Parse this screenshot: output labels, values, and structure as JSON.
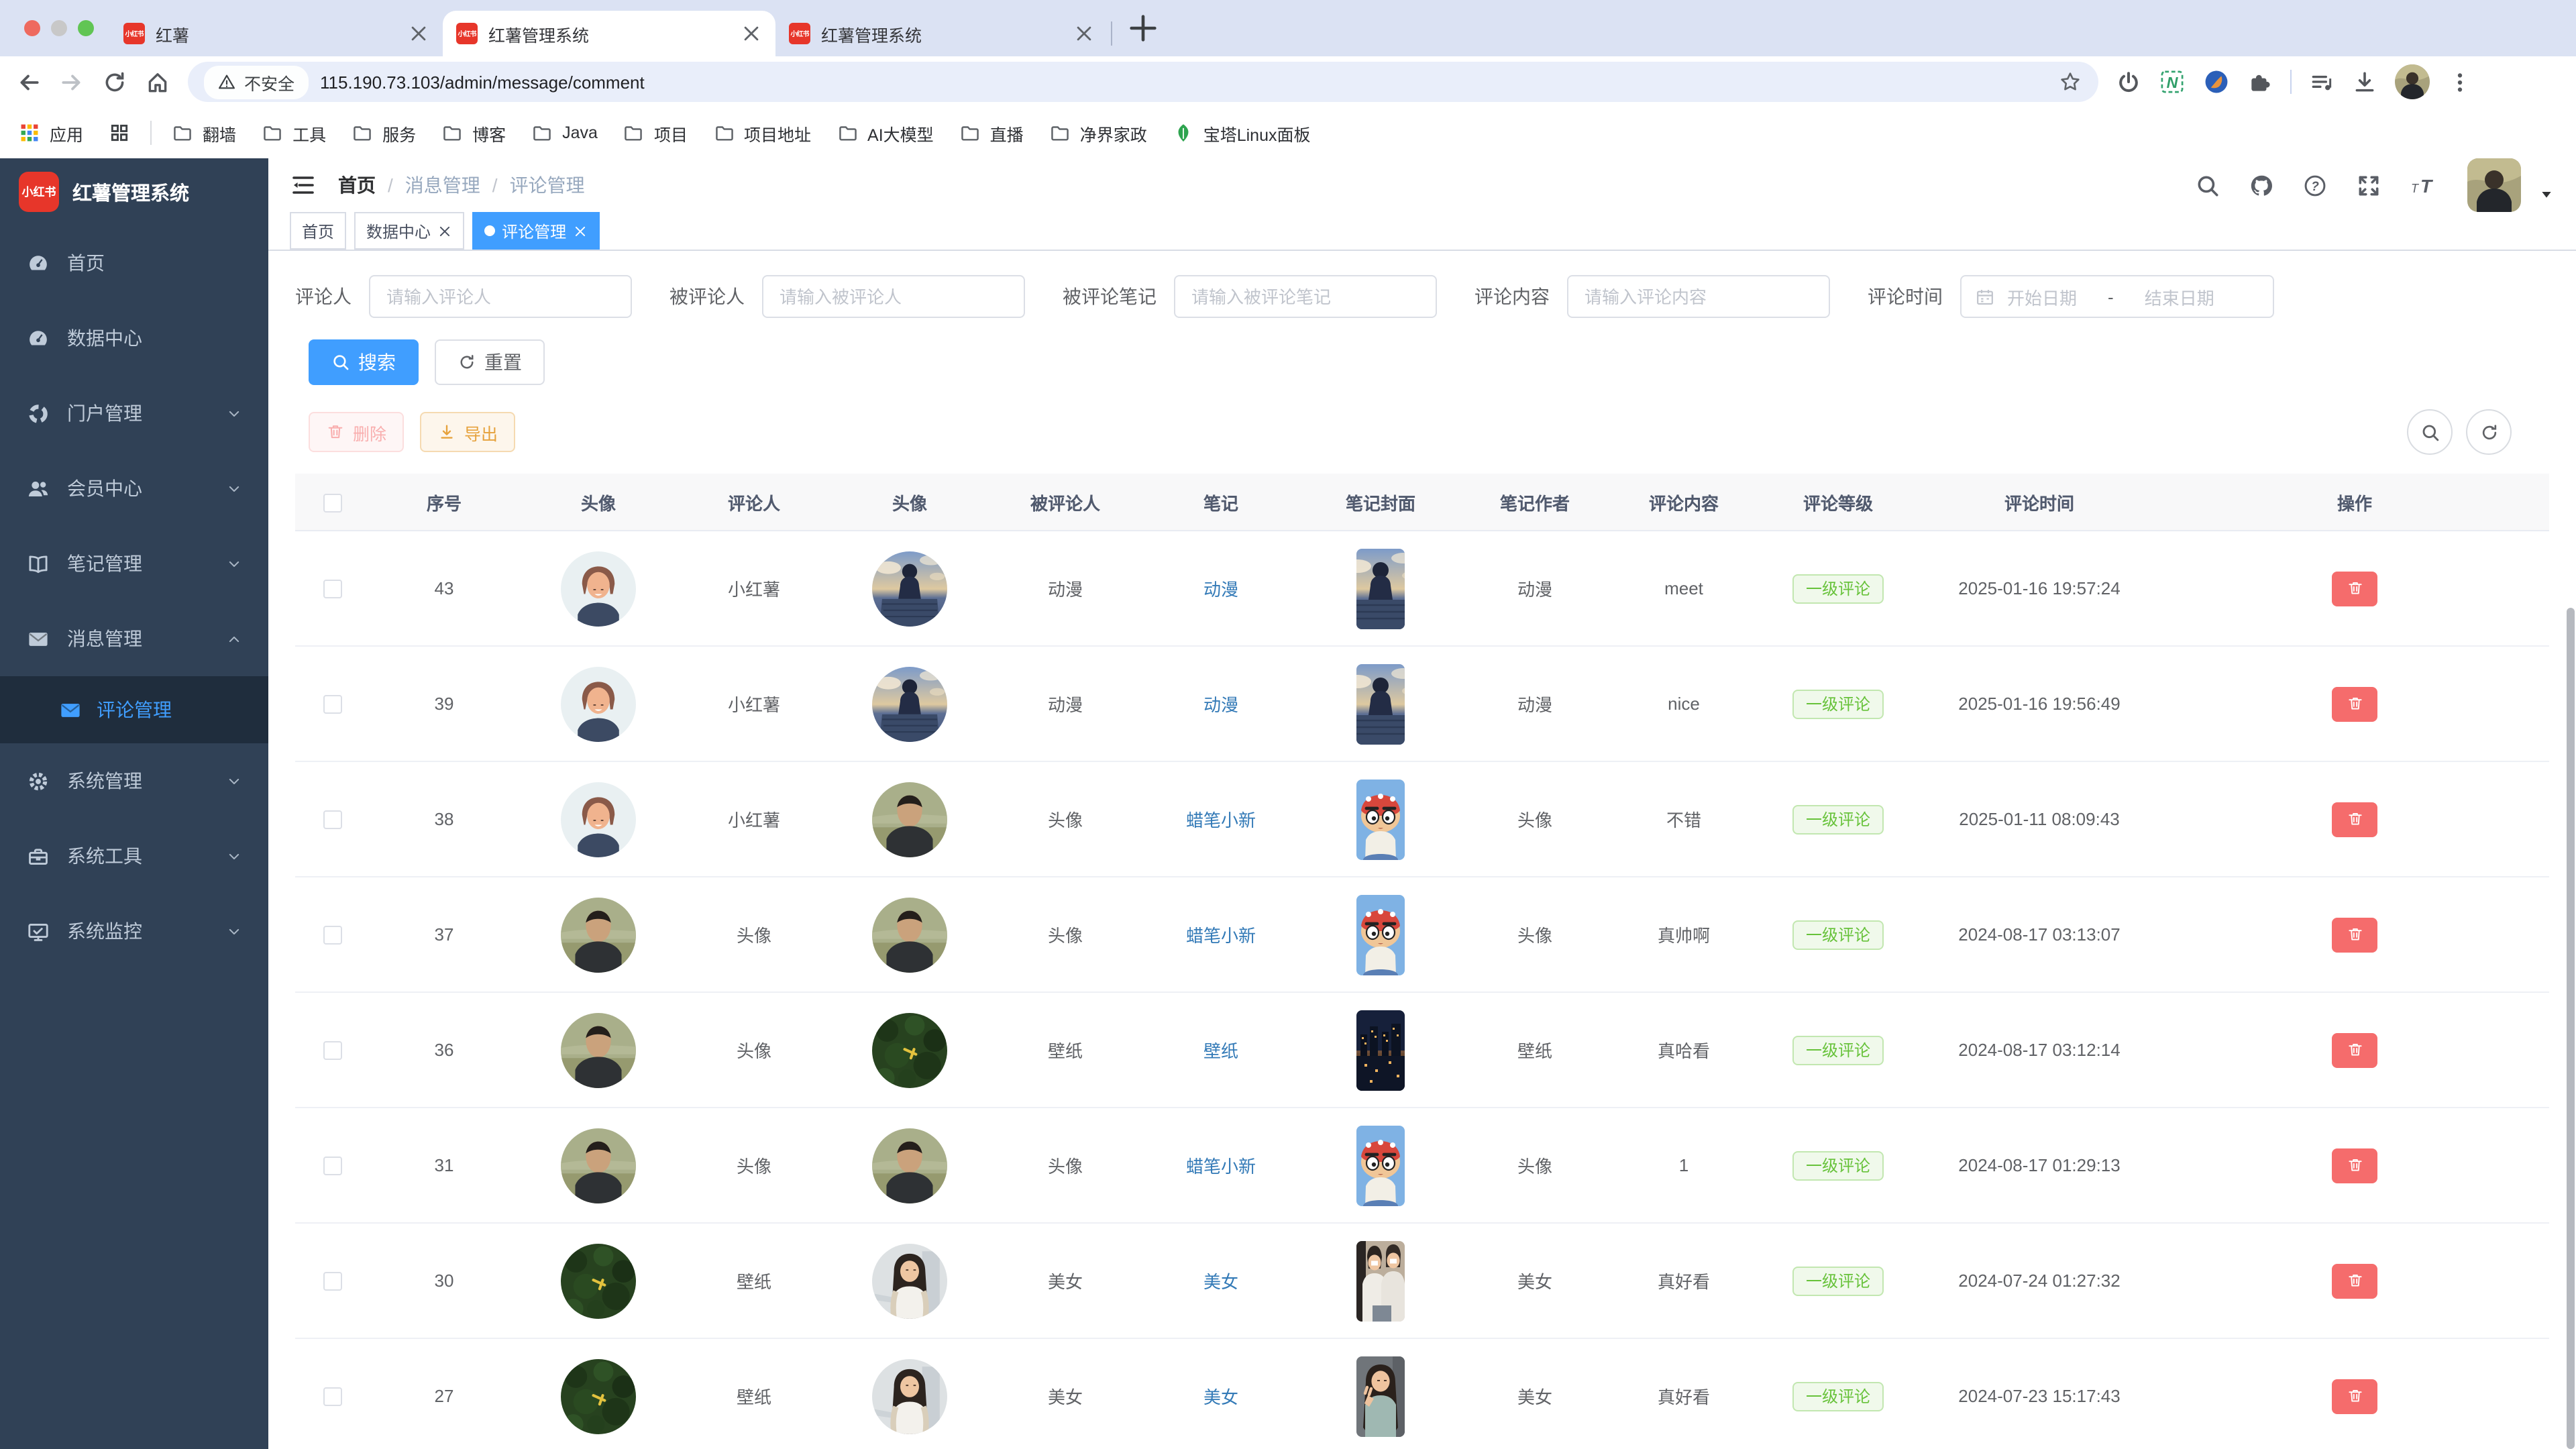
{
  "browser": {
    "tabs": [
      {
        "title": "红薯"
      },
      {
        "title": "红薯管理系统",
        "active": true
      },
      {
        "title": "红薯管理系统"
      }
    ],
    "toolbar": {
      "security_label": "不安全",
      "url": "115.190.73.103/admin/message/comment"
    },
    "bookmarks": {
      "apps_label": "应用",
      "folders": [
        "翻墙",
        "工具",
        "服务",
        "博客",
        "Java",
        "项目",
        "项目地址",
        "AI大模型",
        "直播",
        "净界家政"
      ],
      "bt_label": "宝塔Linux面板"
    }
  },
  "app": {
    "logo_badge": "小红书",
    "logo_title": "红薯管理系统",
    "sidebar": {
      "items": [
        {
          "label": "首页",
          "icon": "gauge"
        },
        {
          "label": "数据中心",
          "icon": "gauge"
        },
        {
          "label": "门户管理",
          "icon": "portal",
          "expandable": true
        },
        {
          "label": "会员中心",
          "icon": "users",
          "expandable": true
        },
        {
          "label": "笔记管理",
          "icon": "book",
          "expandable": true
        },
        {
          "label": "消息管理",
          "icon": "mail",
          "expandable": true,
          "expanded": true
        },
        {
          "label": "评论管理",
          "icon": "mail",
          "child": true,
          "active": true
        },
        {
          "label": "系统管理",
          "icon": "gear",
          "expandable": true
        },
        {
          "label": "系统工具",
          "icon": "toolbox",
          "expandable": true
        },
        {
          "label": "系统监控",
          "icon": "monitor",
          "expandable": true
        }
      ]
    },
    "breadcrumb": {
      "items": [
        "首页",
        "消息管理",
        "评论管理"
      ],
      "separator": "/"
    },
    "tags": [
      {
        "label": "首页"
      },
      {
        "label": "数据中心",
        "closable": true
      },
      {
        "label": "评论管理",
        "closable": true,
        "active": true
      }
    ],
    "filters": {
      "commenter": {
        "label": "评论人",
        "placeholder": "请输入评论人"
      },
      "commentee": {
        "label": "被评论人",
        "placeholder": "请输入被评论人"
      },
      "note": {
        "label": "被评论笔记",
        "placeholder": "请输入被评论笔记"
      },
      "content": {
        "label": "评论内容",
        "placeholder": "请输入评论内容"
      },
      "time": {
        "label": "评论时间",
        "start_placeholder": "开始日期",
        "separator": "-",
        "end_placeholder": "结束日期"
      }
    },
    "buttons": {
      "search": "搜索",
      "reset": "重置",
      "delete": "删除",
      "export": "导出"
    },
    "table": {
      "headers": [
        "序号",
        "头像",
        "评论人",
        "头像",
        "被评论人",
        "笔记",
        "笔记封面",
        "笔记作者",
        "评论内容",
        "评论等级",
        "评论时间",
        "操作"
      ],
      "rows": [
        {
          "no": "43",
          "commenter_avatar": "cartoon-man",
          "commenter": "小红薯",
          "commentee_avatar": "anime-boy",
          "commentee": "动漫",
          "note": "动漫",
          "cover": "anime-boy",
          "author": "动漫",
          "content": "meet",
          "level": "一级评论",
          "time": "2025-01-16 19:57:24"
        },
        {
          "no": "39",
          "commenter_avatar": "cartoon-man",
          "commenter": "小红薯",
          "commentee_avatar": "anime-boy",
          "commentee": "动漫",
          "note": "动漫",
          "cover": "anime-boy",
          "author": "动漫",
          "content": "nice",
          "level": "一级评论",
          "time": "2025-01-16 19:56:49"
        },
        {
          "no": "38",
          "commenter_avatar": "cartoon-man",
          "commenter": "小红薯",
          "commentee_avatar": "photo-man",
          "commentee": "头像",
          "note": "蜡笔小新",
          "cover": "shinchan",
          "author": "头像",
          "content": "不错",
          "level": "一级评论",
          "time": "2025-01-11 08:09:43"
        },
        {
          "no": "37",
          "commenter_avatar": "photo-man",
          "commenter": "头像",
          "commentee_avatar": "photo-man",
          "commentee": "头像",
          "note": "蜡笔小新",
          "cover": "shinchan",
          "author": "头像",
          "content": "真帅啊",
          "level": "一级评论",
          "time": "2024-08-17 03:13:07"
        },
        {
          "no": "36",
          "commenter_avatar": "photo-man",
          "commenter": "头像",
          "commentee_avatar": "forest",
          "commentee": "壁纸",
          "note": "壁纸",
          "cover": "city-night",
          "author": "壁纸",
          "content": "真哈看",
          "level": "一级评论",
          "time": "2024-08-17 03:12:14"
        },
        {
          "no": "31",
          "commenter_avatar": "photo-man",
          "commenter": "头像",
          "commentee_avatar": "photo-man",
          "commentee": "头像",
          "note": "蜡笔小新",
          "cover": "shinchan",
          "author": "头像",
          "content": "1",
          "level": "一级评论",
          "time": "2024-08-17 01:29:13"
        },
        {
          "no": "30",
          "commenter_avatar": "forest",
          "commenter": "壁纸",
          "commentee_avatar": "girl",
          "commentee": "美女",
          "note": "美女",
          "cover": "two-girls",
          "author": "美女",
          "content": "真好看",
          "level": "一级评论",
          "time": "2024-07-24 01:27:32"
        },
        {
          "no": "27",
          "commenter_avatar": "forest",
          "commenter": "壁纸",
          "commentee_avatar": "girl",
          "commentee": "美女",
          "note": "美女",
          "cover": "girl-peace",
          "author": "美女",
          "content": "真好看",
          "level": "一级评论",
          "time": "2024-07-23 15:17:43"
        }
      ]
    },
    "colors": {
      "primary": "#409EFF",
      "success": "#67C23A",
      "danger": "#F56C6C",
      "warning": "#E6A23C",
      "link": "#337AB7",
      "sidebar": "#304156",
      "brand_red": "#E7362A"
    }
  }
}
